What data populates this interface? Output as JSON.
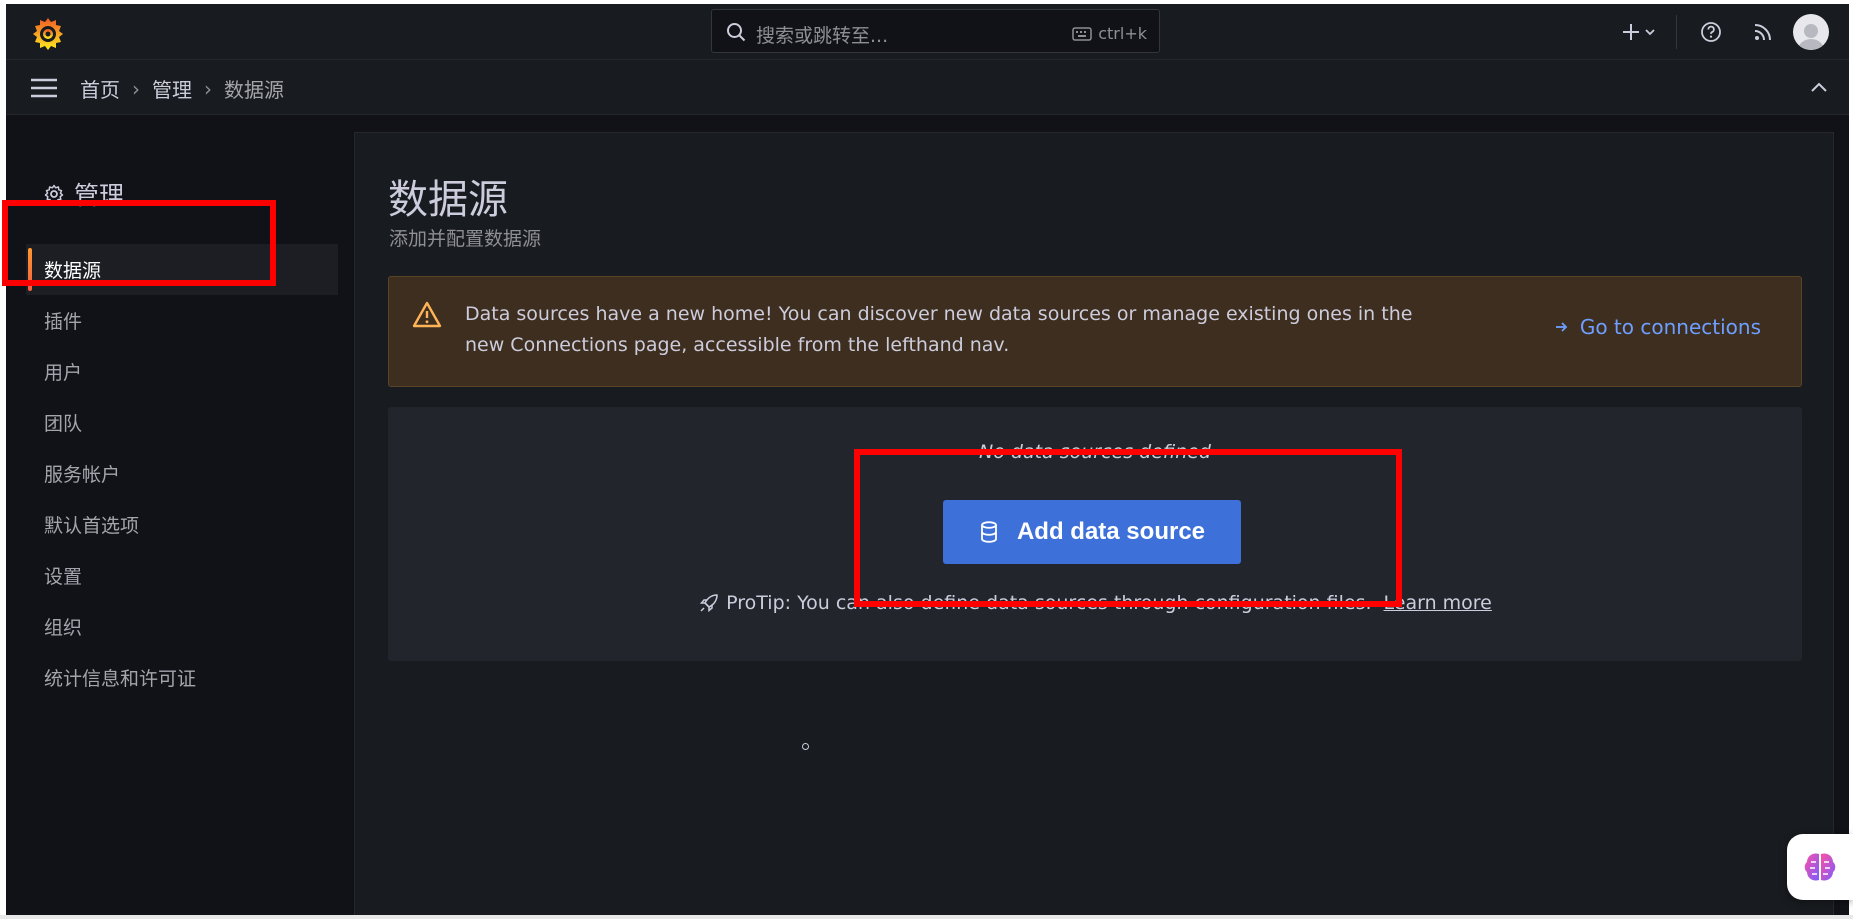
{
  "search": {
    "placeholder": "搜索或跳转至...",
    "shortcut": "ctrl+k"
  },
  "breadcrumb": {
    "home": "首页",
    "admin": "管理",
    "current": "数据源",
    "separator": "›"
  },
  "sidebar": {
    "title": "管理",
    "items": [
      {
        "label": "数据源",
        "active": true
      },
      {
        "label": "插件"
      },
      {
        "label": "用户"
      },
      {
        "label": "团队"
      },
      {
        "label": "服务帐户"
      },
      {
        "label": "默认首选项"
      },
      {
        "label": "设置"
      },
      {
        "label": "组织"
      },
      {
        "label": "统计信息和许可证"
      }
    ]
  },
  "main": {
    "title": "数据源",
    "subtitle": "添加并配置数据源",
    "alert": {
      "message": "Data sources have a new home! You can discover new data sources or manage existing ones in the new Connections page, accessible from the lefthand nav.",
      "link": "Go to connections"
    },
    "empty": {
      "text": "No data sources defined",
      "button": "Add data source",
      "protip": "ProTip: You can also define data sources through configuration files.",
      "learn_more": "Learn more"
    }
  },
  "colors": {
    "accent": "#3d71d9",
    "link": "#6e9fff",
    "warning": "#ffb357",
    "annotation": "#ff0000"
  }
}
